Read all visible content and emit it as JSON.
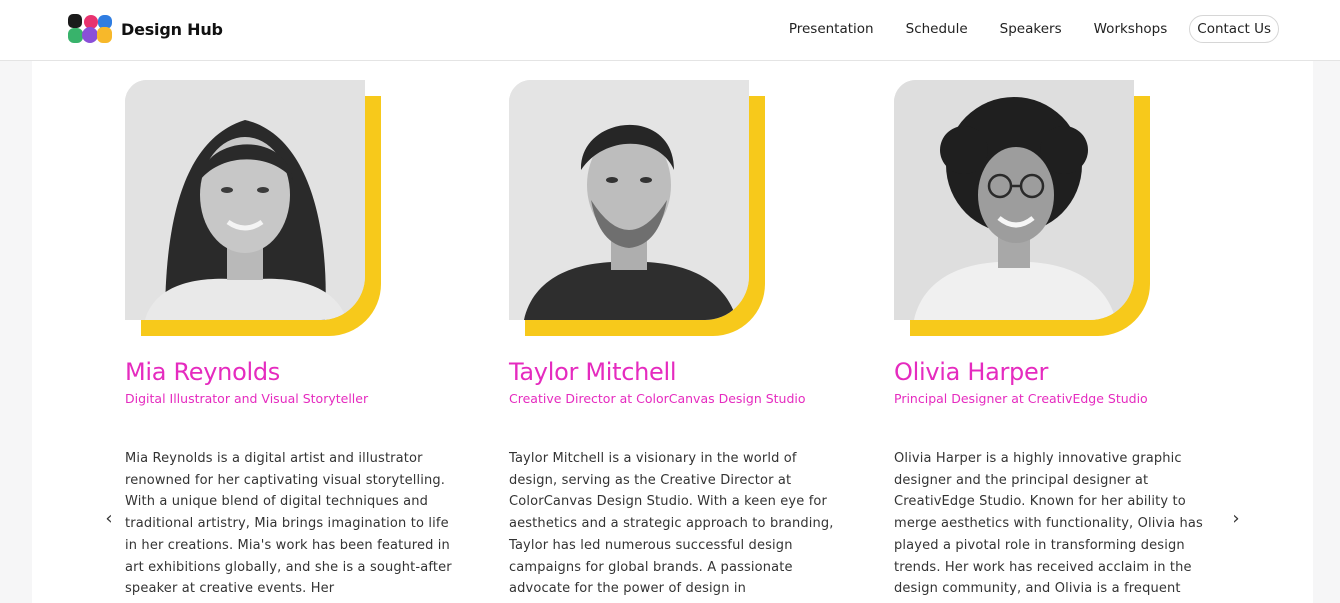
{
  "header": {
    "brand": "Design Hub",
    "logo_colors": [
      "#1a1a1a",
      "#e8336f",
      "#2f7de1",
      "#f7b82a",
      "#38b36b",
      "#8a4fd8"
    ],
    "nav": [
      "Presentation",
      "Schedule",
      "Speakers",
      "Workshops"
    ],
    "contact_label": "Contact Us"
  },
  "accent_color": "#f7c91b",
  "name_color": "#e52bbf",
  "speakers": [
    {
      "name": "Mia Reynolds",
      "role": "Digital Illustrator and Visual Storyteller",
      "bio": "Mia Reynolds is a digital artist and illustrator renowned for her captivating visual storytelling. With a unique blend of digital techniques and traditional artistry, Mia brings imagination to life in her creations. Mia's work has been featured in art exhibitions globally, and she is a sought-after speaker at creative events. Her"
    },
    {
      "name": "Taylor Mitchell",
      "role": "Creative Director at ColorCanvas Design Studio",
      "bio": "Taylor Mitchell is a visionary in the world of design, serving as the Creative Director at ColorCanvas Design Studio. With a keen eye for aesthetics and a strategic approach to branding, Taylor has led numerous successful design campaigns for global brands. A passionate advocate for the power of design in"
    },
    {
      "name": "Olivia Harper",
      "role": "Principal Designer at CreativEdge Studio",
      "bio": "Olivia Harper is a highly innovative graphic designer and the principal designer at CreativEdge Studio. Known for her ability to merge aesthetics with functionality, Olivia has played a pivotal role in transforming design trends. Her work has received acclaim in the design community, and Olivia is a frequent"
    }
  ],
  "carousel": {
    "prev_icon": "chevron-left-icon",
    "next_icon": "chevron-right-icon",
    "prev_glyph": "‹",
    "next_glyph": "›"
  }
}
